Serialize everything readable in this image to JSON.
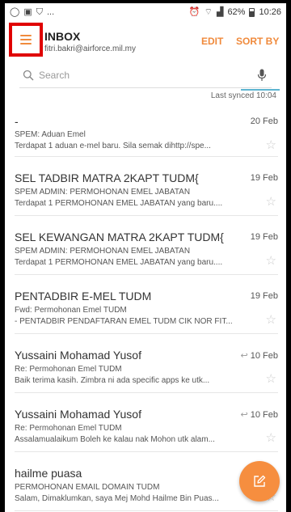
{
  "status_bar": {
    "more": "...",
    "signal_percent": "62%",
    "time": "10:26"
  },
  "header": {
    "title": "INBOX",
    "account": "fitri.bakri@airforce.mil.my",
    "edit_label": "EDIT",
    "sort_label": "SORT BY"
  },
  "search": {
    "placeholder": "Search"
  },
  "sync": {
    "label": "Last synced  10:04"
  },
  "emails": [
    {
      "sender": "-",
      "date": "20 Feb",
      "subject": "SPEM: Aduan Emel",
      "preview": "Terdapat 1 aduan e-mel baru. Sila semak dihttp://spe..."
    },
    {
      "sender": "SEL TADBIR MATRA 2KAPT TUDM{",
      "date": "19 Feb",
      "subject": "SPEM ADMIN: PERMOHONAN EMEL JABATAN",
      "preview": "Terdapat 1 PERMOHONAN EMEL JABATAN yang baru...."
    },
    {
      "sender": "SEL KEWANGAN MATRA 2KAPT TUDM{",
      "date": "19 Feb",
      "subject": "SPEM ADMIN: PERMOHONAN EMEL JABATAN",
      "preview": "Terdapat 1 PERMOHONAN EMEL JABATAN yang baru...."
    },
    {
      "sender": "PENTADBIR E-MEL TUDM",
      "date": "19 Feb",
      "subject": "Fwd: Permohonan Emel TUDM",
      "preview": "- PENTADBIR PENDAFTARAN EMEL TUDM CIK NOR FIT..."
    },
    {
      "sender": "Yussaini Mohamad Yusof",
      "date": "10 Feb",
      "subject": "Re: Permohonan Emel TUDM",
      "preview": "Baik terima kasih.  Zimbra ni ada specific apps ke utk..."
    },
    {
      "sender": "Yussaini Mohamad Yusof",
      "date": "10 Feb",
      "subject": "Re: Permohonan Emel TUDM",
      "preview": "Assalamualaikum Boleh ke kalau nak Mohon utk alam..."
    },
    {
      "sender": "hailme puasa",
      "date": "",
      "subject": "PERMOHONAN EMAIL DOMAIN TUDM",
      "preview": "Salam, Dimaklumkan, saya Mej Mohd Hailme Bin Puas..."
    }
  ],
  "icons": {
    "reply": "↩",
    "star": "☆"
  },
  "colors": {
    "accent": "#f08a3c",
    "fab": "#f68e3f",
    "highlight_box": "#e00000",
    "sync_line": "#5eb5d1"
  }
}
